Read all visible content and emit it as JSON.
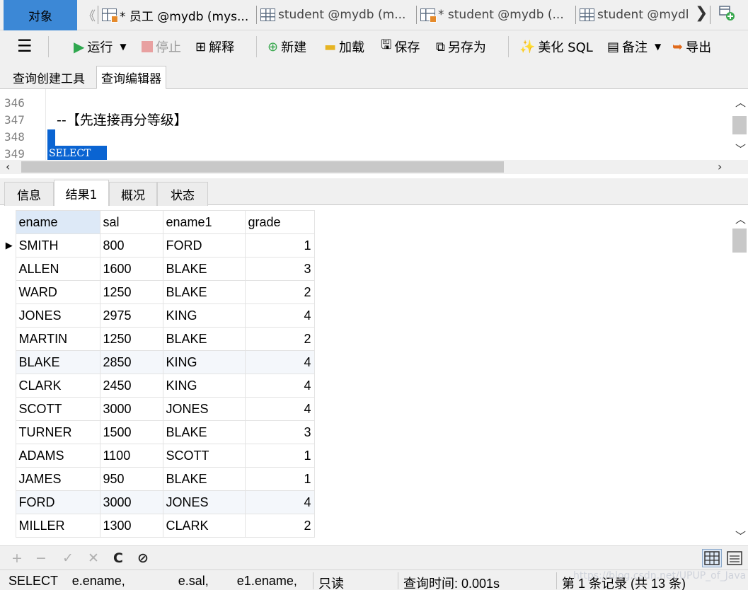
{
  "doc_tabs": {
    "objects": "对象",
    "tabs": [
      {
        "label": "* 员工 @mydb (mys...",
        "icon": "query-icon"
      },
      {
        "label": "student @mydb (m...",
        "icon": "table-icon"
      },
      {
        "label": "* student @mydb (...",
        "icon": "query-icon"
      },
      {
        "label": "student @mydl",
        "icon": "table-icon"
      }
    ]
  },
  "toolbar": {
    "run": "运行",
    "stop": "停止",
    "explain": "解释",
    "new": "新建",
    "load": "加载",
    "save": "保存",
    "save_as": "另存为",
    "beautify": "美化 SQL",
    "comment": "备注",
    "export": "导出"
  },
  "sub_tabs": [
    "查询创建工具",
    "查询编辑器"
  ],
  "editor": {
    "line_numbers": [
      "346",
      "347",
      "348",
      "349"
    ],
    "line_347": "--【先连接再分等级】",
    "line_349": "SELECT"
  },
  "result_tabs": [
    "信息",
    "结果1",
    "概况",
    "状态"
  ],
  "grid": {
    "columns": [
      "ename",
      "sal",
      "ename1",
      "grade"
    ],
    "rows": [
      [
        "SMITH",
        "800",
        "FORD",
        "1"
      ],
      [
        "ALLEN",
        "1600",
        "BLAKE",
        "3"
      ],
      [
        "WARD",
        "1250",
        "BLAKE",
        "2"
      ],
      [
        "JONES",
        "2975",
        "KING",
        "4"
      ],
      [
        "MARTIN",
        "1250",
        "BLAKE",
        "2"
      ],
      [
        "BLAKE",
        "2850",
        "KING",
        "4"
      ],
      [
        "CLARK",
        "2450",
        "KING",
        "4"
      ],
      [
        "SCOTT",
        "3000",
        "JONES",
        "4"
      ],
      [
        "TURNER",
        "1500",
        "BLAKE",
        "3"
      ],
      [
        "ADAMS",
        "1100",
        "SCOTT",
        "1"
      ],
      [
        "JAMES",
        "950",
        "BLAKE",
        "1"
      ],
      [
        "FORD",
        "3000",
        "JONES",
        "4"
      ],
      [
        "MILLER",
        "1300",
        "CLARK",
        "2"
      ]
    ]
  },
  "gridbar": {
    "add": "+",
    "delete": "−",
    "apply": "✓",
    "discard": "✕",
    "refresh": "C",
    "stop": "⊘"
  },
  "status": {
    "sql": "SELECT    e.ename,               e.sal,        e1.ename,",
    "readonly": "只读",
    "query_time": "查询时间: 0.001s",
    "records": "第 1 条记录 (共 13 条)"
  },
  "watermark": "https://blog.csdn.net/UPUP_of_Java",
  "colors": {
    "active_tab": "#3c88d6",
    "selection": "#0a64d2",
    "run_green": "#2fa84f",
    "stop_red": "#e27a7a"
  }
}
